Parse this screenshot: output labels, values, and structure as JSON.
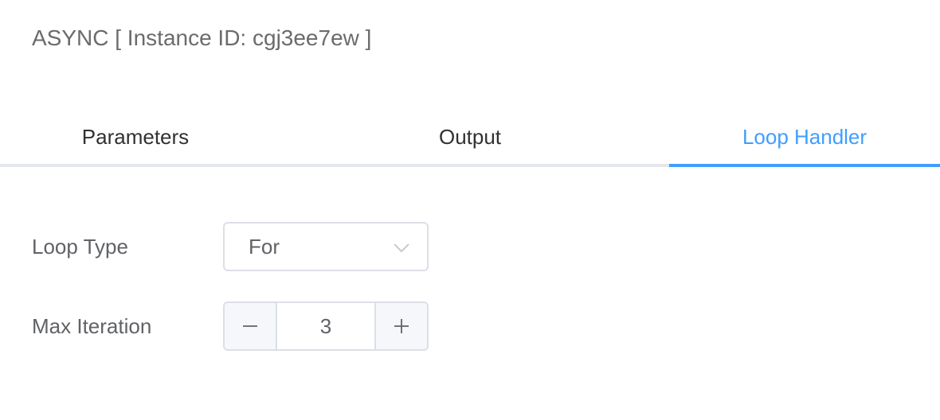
{
  "header": {
    "title": "ASYNC [ Instance ID: cgj3ee7ew ]"
  },
  "tabs": [
    {
      "label": "Parameters",
      "active": false
    },
    {
      "label": "Output",
      "active": false
    },
    {
      "label": "Loop Handler",
      "active": true
    }
  ],
  "form": {
    "loop_type": {
      "label": "Loop Type",
      "value": "For",
      "icon": "chevron-down-icon"
    },
    "max_iteration": {
      "label": "Max Iteration",
      "value": "3",
      "decrement_icon": "minus-icon",
      "increment_icon": "plus-icon"
    }
  },
  "colors": {
    "accent": "#409eff",
    "text_primary": "#303133",
    "text_regular": "#606266",
    "border": "#dcdfe6",
    "tab_border": "#e4e7ed",
    "stepper_bg": "#f5f7fa"
  }
}
